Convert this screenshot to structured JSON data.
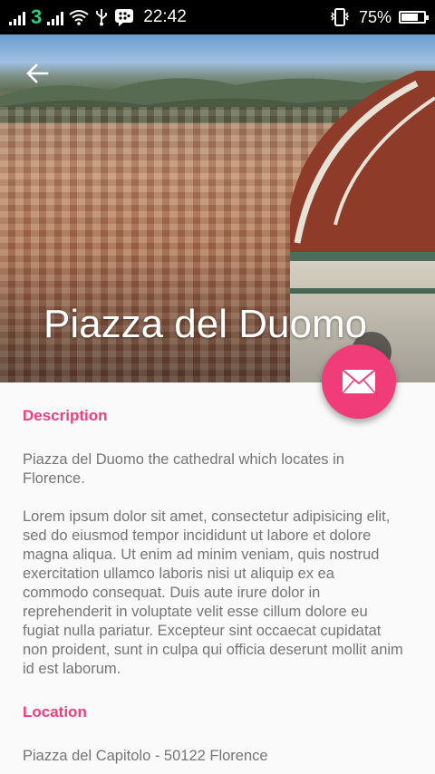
{
  "status_bar": {
    "time": "22:42",
    "battery_percent": "75%",
    "battery_level": 0.75,
    "carrier_symbol": "3",
    "icons": [
      "signal-icon",
      "signal-icon",
      "wifi-icon",
      "usb-icon",
      "blackberry-messenger-icon",
      "vibrate-icon",
      "battery-icon"
    ]
  },
  "header": {
    "title": "Piazza del Duomo",
    "back_icon": "arrow-back-icon"
  },
  "fab": {
    "icon": "mail-icon",
    "color": "#f03c78"
  },
  "sections": {
    "description_heading": "Description",
    "description_intro": "Piazza del Duomo the cathedral which locates in Florence.",
    "description_body": "Lorem ipsum dolor sit amet, consectetur adipisicing elit, sed do eiusmod tempor incididunt ut labore et dolore magna aliqua. Ut enim ad minim veniam, quis nostrud exercitation ullamco laboris nisi ut aliquip ex ea commodo consequat. Duis aute irure dolor in reprehenderit in voluptate velit esse cillum dolore eu fugiat nulla pariatur. Excepteur sint occaecat cupidatat non proident, sunt in culpa qui officia deserunt mollit anim id est laborum.",
    "location_heading": "Location",
    "location_text": "Piazza del Capitolo - 50122 Florence"
  },
  "colors": {
    "accent": "#ec407a",
    "text": "#757575",
    "background": "#fafafa"
  }
}
